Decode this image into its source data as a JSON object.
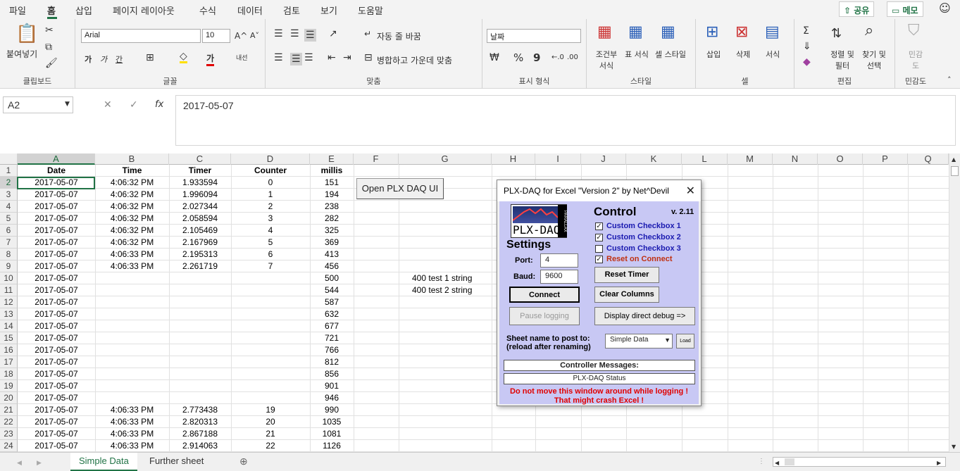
{
  "menu": {
    "items": [
      "파일",
      "홈",
      "삽입",
      "페이지 레이아웃",
      "수식",
      "데이터",
      "검토",
      "보기",
      "도움말"
    ],
    "share": "공유",
    "memo": "메모"
  },
  "ribbon": {
    "clipboard": {
      "paste": "붙여넣기",
      "label": "클립보드"
    },
    "font": {
      "name": "Arial",
      "size": "10",
      "label": "글꼴",
      "bold": "가",
      "italic": "가",
      "underline": "간",
      "wrap_vertical": "내선"
    },
    "align": {
      "wrap": "자동 줄 바꿈",
      "merge": "병합하고 가운데 맞춤",
      "label": "맞춤"
    },
    "number": {
      "format": "날짜",
      "label": "표시 형식",
      "percent": "%",
      "comma": "9"
    },
    "styles": {
      "cond": "조건부 서식",
      "table": "표 서식",
      "cell": "셀 스타일",
      "label": "스타일"
    },
    "cells": {
      "insert": "삽입",
      "delete": "삭제",
      "format": "서식",
      "label": "셀"
    },
    "edit": {
      "sort": "정렬 및 필터",
      "find": "찾기 및 선택",
      "label": "편집"
    },
    "sensitivity": {
      "btn": "민감도",
      "label": "민감도"
    }
  },
  "formula_bar": {
    "name_box": "A2",
    "value": "2017-05-07"
  },
  "columns": [
    "A",
    "B",
    "C",
    "D",
    "E",
    "F",
    "G",
    "H",
    "I",
    "J",
    "K",
    "L",
    "M",
    "N",
    "O",
    "P",
    "Q"
  ],
  "headers": [
    "Date",
    "Time",
    "Timer",
    "Counter",
    "millis"
  ],
  "rows": [
    [
      "2017-05-07",
      "4:06:32 PM",
      "1.933594",
      "0",
      "151"
    ],
    [
      "2017-05-07",
      "4:06:32 PM",
      "1.996094",
      "1",
      "194"
    ],
    [
      "2017-05-07",
      "4:06:32 PM",
      "2.027344",
      "2",
      "238"
    ],
    [
      "2017-05-07",
      "4:06:32 PM",
      "2.058594",
      "3",
      "282"
    ],
    [
      "2017-05-07",
      "4:06:32 PM",
      "2.105469",
      "4",
      "325"
    ],
    [
      "2017-05-07",
      "4:06:32 PM",
      "2.167969",
      "5",
      "369"
    ],
    [
      "2017-05-07",
      "4:06:33 PM",
      "2.195313",
      "6",
      "413"
    ],
    [
      "2017-05-07",
      "4:06:33 PM",
      "2.261719",
      "7",
      "456"
    ],
    [
      "2017-05-07",
      "",
      "",
      "",
      "500"
    ],
    [
      "2017-05-07",
      "",
      "",
      "",
      "544"
    ],
    [
      "2017-05-07",
      "",
      "",
      "",
      "587"
    ],
    [
      "2017-05-07",
      "",
      "",
      "",
      "632"
    ],
    [
      "2017-05-07",
      "",
      "",
      "",
      "677"
    ],
    [
      "2017-05-07",
      "",
      "",
      "",
      "721"
    ],
    [
      "2017-05-07",
      "",
      "",
      "",
      "766"
    ],
    [
      "2017-05-07",
      "",
      "",
      "",
      "812"
    ],
    [
      "2017-05-07",
      "",
      "",
      "",
      "856"
    ],
    [
      "2017-05-07",
      "",
      "",
      "",
      "901"
    ],
    [
      "2017-05-07",
      "",
      "",
      "",
      "946"
    ],
    [
      "2017-05-07",
      "4:06:33 PM",
      "2.773438",
      "19",
      "990"
    ],
    [
      "2017-05-07",
      "4:06:33 PM",
      "2.820313",
      "20",
      "1035"
    ],
    [
      "2017-05-07",
      "4:06:33 PM",
      "2.867188",
      "21",
      "1081"
    ],
    [
      "2017-05-07",
      "4:06:33 PM",
      "2.914063",
      "22",
      "1126"
    ]
  ],
  "g_cells": {
    "row10": "400 test 1 string",
    "row11": "400 test 2 string"
  },
  "plx_button": "Open PLX DAQ UI",
  "sheets": [
    "Simple Data",
    "Further sheet"
  ],
  "dialog": {
    "title": "PLX-DAQ for Excel \"Version 2\" by Net^Devil",
    "logo": "PLX-DAQ",
    "logo_side": "PARALLAX",
    "control": "Control",
    "version": "v. 2.11",
    "checkboxes": [
      "Custom Checkbox 1",
      "Custom Checkbox 2",
      "Custom Checkbox 3",
      "Reset on Connect"
    ],
    "settings": "Settings",
    "port_label": "Port:",
    "port": "4",
    "baud_label": "Baud:",
    "baud": "9600",
    "reset_timer": "Reset Timer",
    "connect": "Connect",
    "clear_columns": "Clear Columns",
    "pause": "Pause logging",
    "debug": "Display direct debug =>",
    "sheet_label1": "Sheet name to post to:",
    "sheet_label2": "(reload after renaming)",
    "sheet_value": "Simple Data",
    "load": "Load",
    "ctrl_msgs": "Controller Messages:",
    "status": "PLX-DAQ Status",
    "warn1": "Do not move this window around while logging !",
    "warn2": "That might crash Excel !"
  }
}
